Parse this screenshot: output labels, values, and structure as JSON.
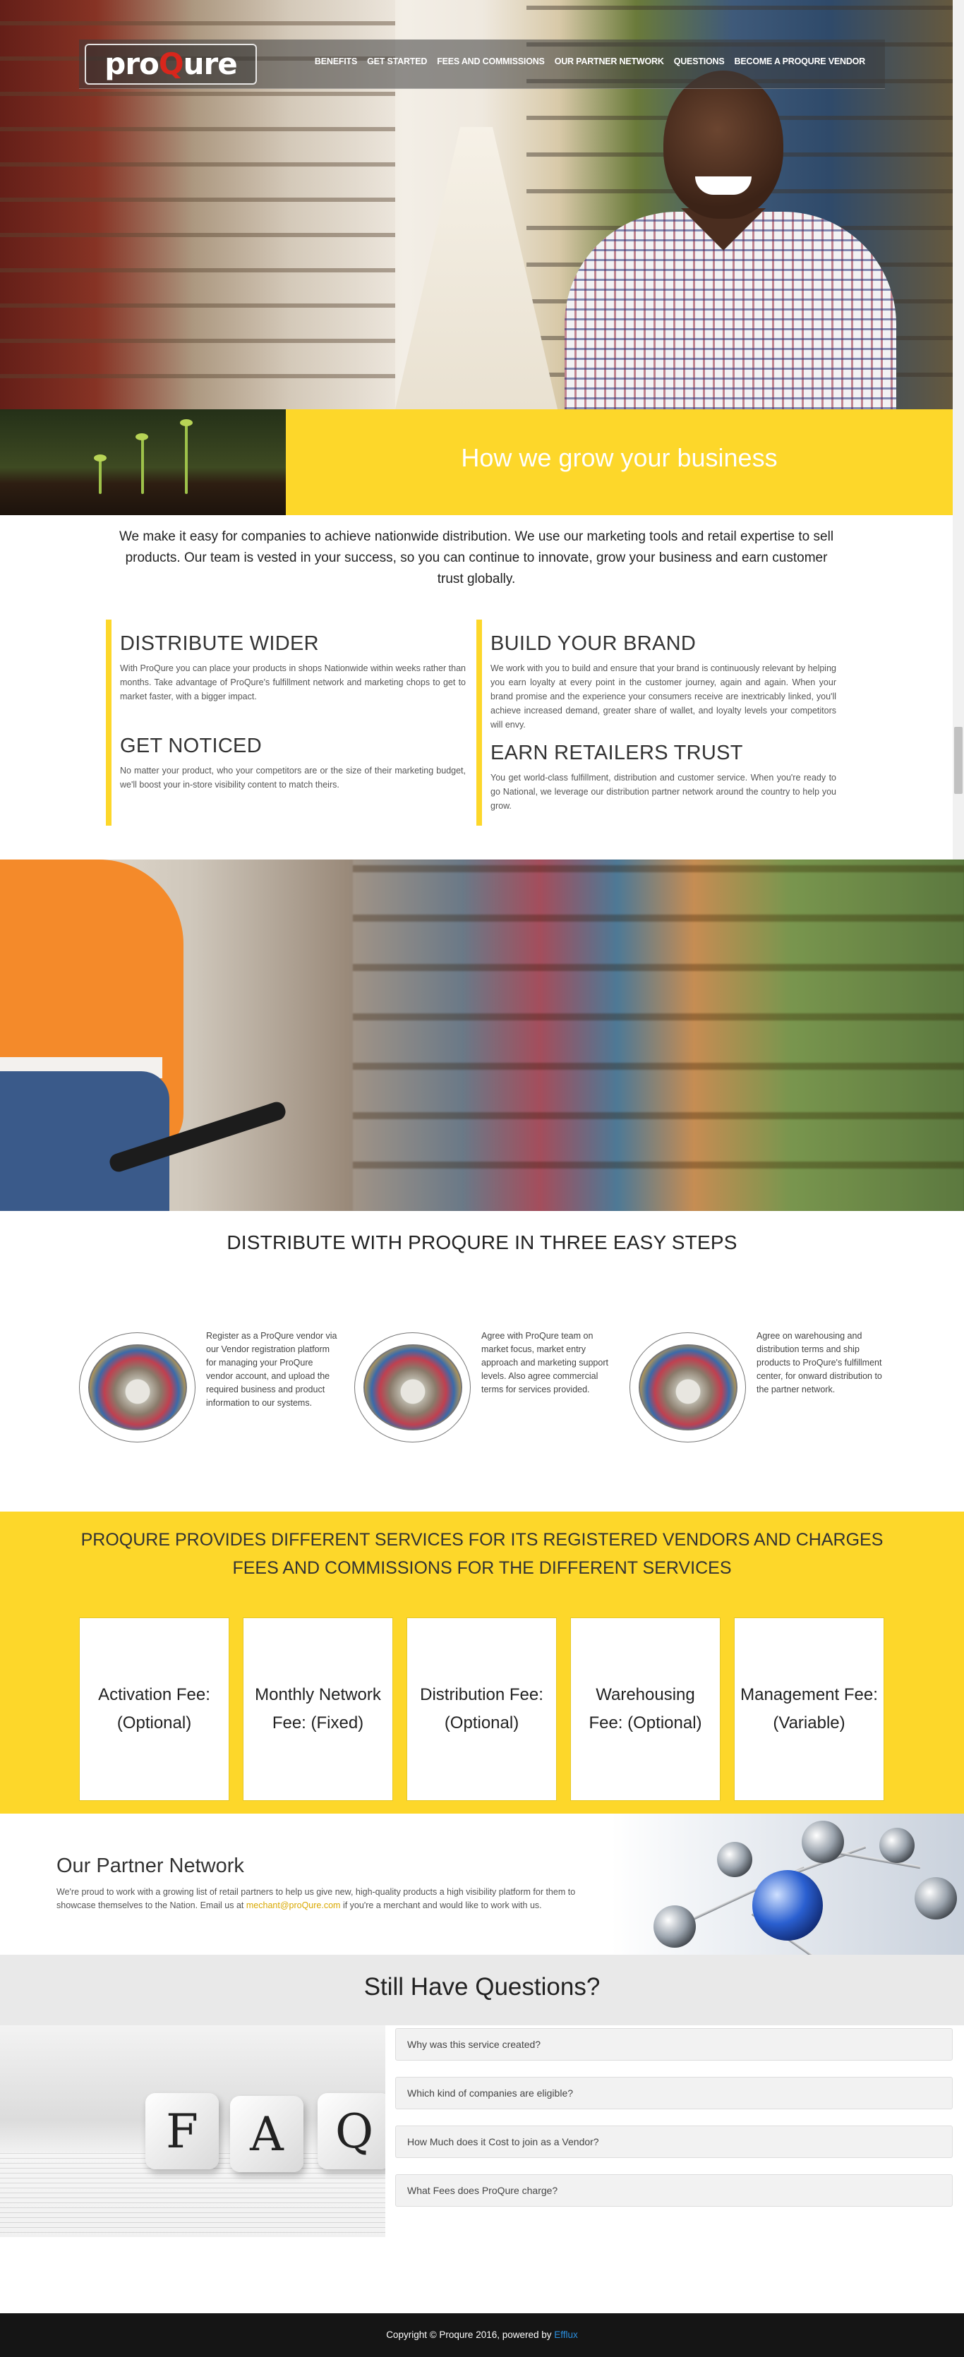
{
  "header": {
    "logo": {
      "pre": "pro",
      "q": "Q",
      "post": "ure"
    },
    "nav": [
      "BENEFITS",
      "GET STARTED",
      "FEES AND COMMISSIONS",
      "OUR PARTNER NETWORK",
      "QUESTIONS",
      "BECOME A PROQURE VENDOR"
    ]
  },
  "grow": {
    "title": "How we grow your business"
  },
  "intro": "We make it easy for companies to achieve nationwide distribution. We use our marketing tools and retail expertise to sell products. Our team is vested in your success, so you can continue to innovate, grow your business and earn customer trust globally.",
  "features": {
    "left": [
      {
        "title": "DISTRIBUTE WIDER",
        "text": "With ProQure you can place your products in shops Nationwide within weeks rather than months. Take advantage of ProQure's fulfillment network and marketing chops to get to market faster, with a bigger impact."
      },
      {
        "title": "GET NOTICED",
        "text": "No matter your product, who your competitors are or the size of their marketing budget, we'll boost your in-store visibility content to match theirs."
      }
    ],
    "right": [
      {
        "title": "BUILD YOUR BRAND",
        "text": "We work with you to build and ensure that your brand is continuously relevant by helping you earn loyalty at every point in the customer journey, again and again. When your brand promise and the experience your consumers receive are inextricably linked, you'll achieve increased demand, greater share of wallet, and loyalty levels your competitors will envy."
      },
      {
        "title": "EARN RETAILERS TRUST",
        "text": "You get world-class fulfillment, distribution and customer service. When you're ready to go National, we leverage our distribution partner network around the country to help you grow."
      }
    ]
  },
  "steps": {
    "title": "DISTRIBUTE WITH PROQURE IN THREE EASY STEPS",
    "items": [
      "Register as a ProQure vendor via our Vendor registration platform for managing your ProQure vendor account, and upload the required business and product information to our systems.",
      "Agree with ProQure team on market focus, market entry approach and marketing support levels. Also agree commercial terms for services provided.",
      "Agree on warehousing and distribution terms and ship products to ProQure's fulfillment center, for onward distribution to the partner network."
    ]
  },
  "fees": {
    "title_line1": "PROQURE PROVIDES DIFFERENT SERVICES FOR ITS REGISTERED VENDORS AND CHARGES",
    "title_line2": "FEES AND COMMISSIONS FOR THE DIFFERENT SERVICES",
    "cards": [
      "Activation Fee: (Optional)",
      "Monthly Network Fee: (Fixed)",
      "Distribution Fee: (Optional)",
      "Warehousing Fee: (Optional)",
      "Management Fee: (Variable)"
    ]
  },
  "partner": {
    "title": "Our Partner Network",
    "text_before": "We're proud to work with a growing list of retail partners to help us give new, high-quality products a high visibility platform for them to showcase themselves to the Nation. Email us at ",
    "email": "mechant@proQure.com",
    "text_after": " if you're a merchant and would like to work with us."
  },
  "questions": {
    "title": "Still Have Questions?",
    "image_letters": [
      "F",
      "A",
      "Q"
    ],
    "items": [
      "Why was this service created?",
      "Which kind of companies are eligible?",
      "How Much does it Cost to join as a Vendor?",
      "What Fees does ProQure charge?"
    ]
  },
  "footer": {
    "text": "Copyright © Proqure 2016, powered by ",
    "powered": "Efflux"
  },
  "colors": {
    "accent": "#fdd72a",
    "logo_q": "#d8261c",
    "footer_bg": "#151515",
    "link_blue": "#2a8fe0"
  }
}
